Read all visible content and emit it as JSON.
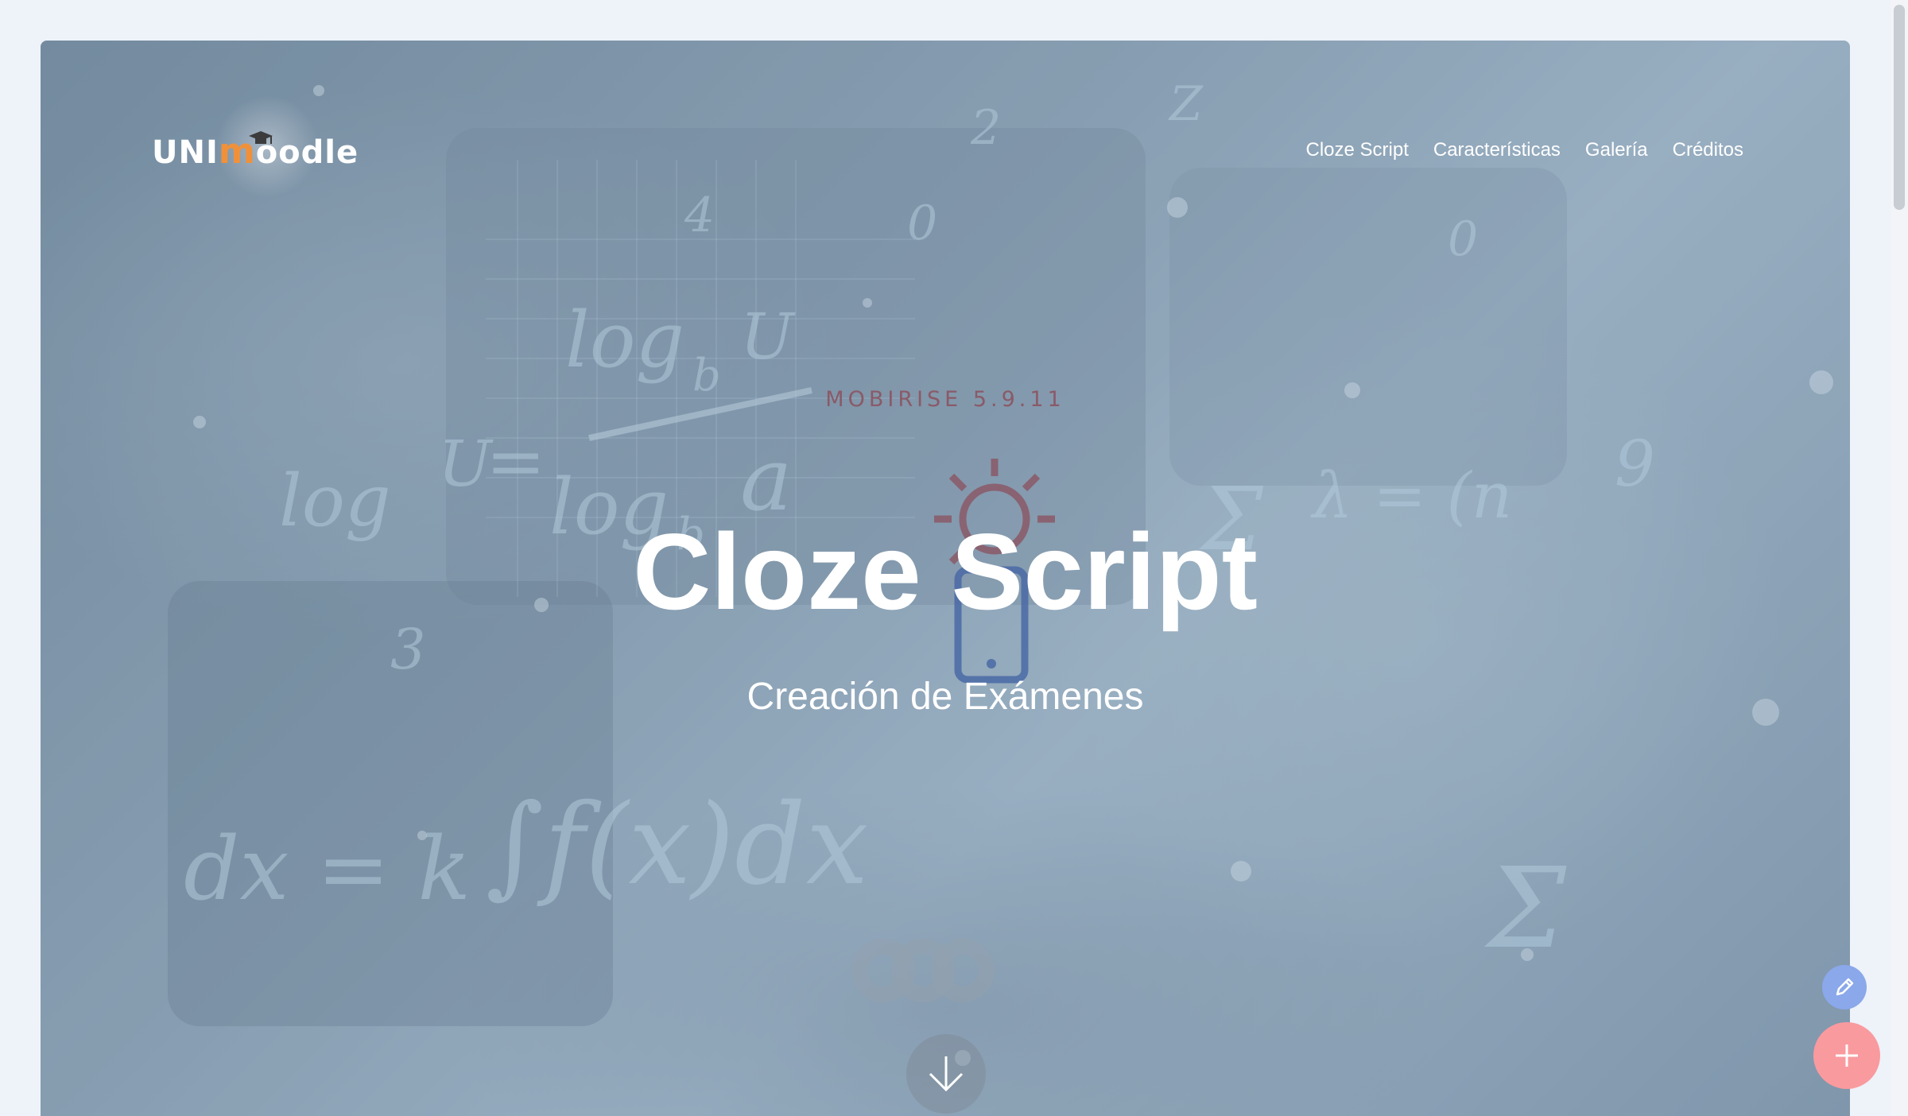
{
  "logo": {
    "prefix": "UNI",
    "m_letter": "m",
    "suffix": "oodle"
  },
  "nav": {
    "items": [
      {
        "label": "Cloze Script"
      },
      {
        "label": "Características"
      },
      {
        "label": "Galería"
      },
      {
        "label": "Créditos"
      }
    ]
  },
  "hero": {
    "badge": "MOBIRISE  5.9.11",
    "title": "Cloze Script",
    "subtitle": "Creación de Exámenes",
    "background_formulas": [
      "log",
      "b",
      "U",
      "log",
      "b",
      "a",
      "f(x)dx",
      "k",
      "Σ",
      "4",
      "0",
      "3",
      "9",
      "2"
    ]
  },
  "icons": {
    "scroll": "arrow-down-icon",
    "edit": "pencil-icon",
    "add": "plus-icon",
    "ghost_sun": "sun-icon",
    "ghost_phone": "mobile-icon",
    "cap": "graduation-cap-icon"
  },
  "colors": {
    "page_bg": "#eef2f9",
    "logo_accent": "#f0913a",
    "badge": "#8a5a68",
    "fab_edit": "#8aa8ea",
    "fab_add": "#f99a9f"
  }
}
